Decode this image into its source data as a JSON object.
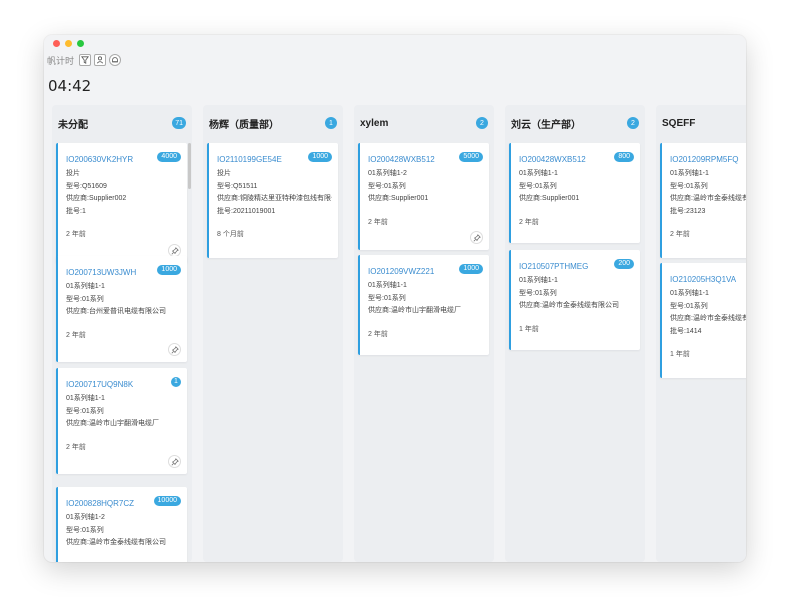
{
  "toolbar": {
    "label": "帆计时",
    "icons": [
      "filter-icon",
      "user-icon",
      "bell-icon"
    ]
  },
  "clock": "04:42",
  "colors": {
    "accent": "#3aa8e0",
    "link": "#3a8ccf"
  },
  "columns": [
    {
      "title": "未分配",
      "count": "71",
      "cards": [
        {
          "id": "IO200630VK2HYR",
          "badge": "4000",
          "lines": [
            "投片",
            "型号:Q51609",
            "供应商:Supplier002",
            "批号:1"
          ],
          "time": "2 年前",
          "pin": true
        },
        {
          "id": "IO200713UW3JWH",
          "badge": "1000",
          "lines": [
            "01系列轴1-1",
            "型号:01系列",
            "供应商:台州爱普讯电缆有限公司"
          ],
          "time": "2 年前",
          "pin": true
        },
        {
          "id": "IO200717UQ9N8K",
          "badge": "1",
          "lines": [
            "01系列轴1-1",
            "型号:01系列",
            "供应商:温岭市山宇翻滑电缆厂"
          ],
          "time": "2 年前",
          "pin": true
        },
        {
          "id": "IO200828HQR7CZ",
          "badge": "10000",
          "lines": [
            "01系列轴1-2",
            "型号:01系列",
            "供应商:温岭市金泰线缆有限公司"
          ],
          "time": "",
          "pin": false
        }
      ]
    },
    {
      "title": "杨辉（质量部）",
      "count": "1",
      "cards": [
        {
          "id": "IO2110199GE54E",
          "badge": "1000",
          "lines": [
            "投片",
            "型号:Q51511",
            "供应商:铜陵精达里亚特种漆包线有限公司",
            "批号:20211019001"
          ],
          "time": "8 个月前",
          "pin": false
        }
      ]
    },
    {
      "title": "xylem",
      "count": "2",
      "cards": [
        {
          "id": "IO200428WXB512",
          "badge": "5000",
          "lines": [
            "01系列轴1-2",
            "型号:01系列",
            "供应商:Supplier001"
          ],
          "time": "2 年前",
          "pin": true
        },
        {
          "id": "IO201209VWZ221",
          "badge": "1000",
          "lines": [
            "01系列轴1-1",
            "型号:01系列",
            "供应商:温岭市山宇翻滑电缆厂"
          ],
          "time": "2 年前",
          "pin": false
        }
      ]
    },
    {
      "title": "刘云（生产部）",
      "count": "2",
      "cards": [
        {
          "id": "IO200428WXB512",
          "badge": "800",
          "lines": [
            "01系列轴1-1",
            "型号:01系列",
            "供应商:Supplier001"
          ],
          "time": "2 年前",
          "pin": false
        },
        {
          "id": "IO210507PTHMEG",
          "badge": "200",
          "lines": [
            "01系列轴1-1",
            "型号:01系列",
            "供应商:温岭市金泰线缆有限公司"
          ],
          "time": "1 年前",
          "pin": false
        }
      ]
    },
    {
      "title": "SQEFF",
      "count": "",
      "cards": [
        {
          "id": "IO201209RPM5FQ",
          "badge": "",
          "lines": [
            "01系列轴1-1",
            "型号:01系列",
            "供应商:温岭市金泰线缆有限公",
            "批号:23123"
          ],
          "time": "2 年前",
          "pin": false
        },
        {
          "id": "IO210205H3Q1VA",
          "badge": "",
          "lines": [
            "01系列轴1-1",
            "型号:01系列",
            "供应商:温岭市金泰线缆有限公",
            "批号:1414"
          ],
          "time": "1 年前",
          "pin": false
        }
      ]
    }
  ]
}
